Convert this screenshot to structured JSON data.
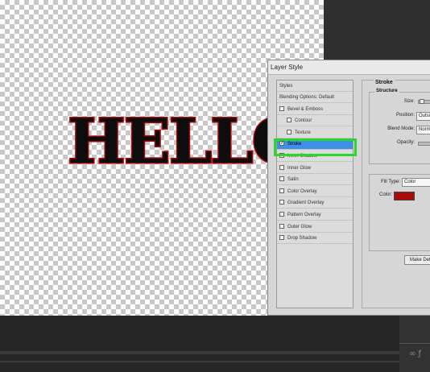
{
  "canvas": {
    "text": "HELLO",
    "text_color": "#0d0d0d",
    "stroke_color": "#b01010"
  },
  "dialog": {
    "title": "Layer Style",
    "styles_header": "Styles",
    "items": [
      {
        "label": "Blending Options: Default",
        "checkbox": false
      },
      {
        "label": "Bevel & Emboss",
        "checkbox": true,
        "checked": false
      },
      {
        "label": "Contour",
        "checkbox": true,
        "checked": false,
        "indent": true
      },
      {
        "label": "Texture",
        "checkbox": true,
        "checked": false,
        "indent": true
      },
      {
        "label": "Stroke",
        "checkbox": true,
        "checked": true,
        "selected": true
      },
      {
        "label": "Inner Shadow",
        "checkbox": true,
        "checked": false
      },
      {
        "label": "Inner Glow",
        "checkbox": true,
        "checked": false
      },
      {
        "label": "Satin",
        "checkbox": true,
        "checked": false
      },
      {
        "label": "Color Overlay",
        "checkbox": true,
        "checked": false
      },
      {
        "label": "Gradient Overlay",
        "checkbox": true,
        "checked": false
      },
      {
        "label": "Pattern Overlay",
        "checkbox": true,
        "checked": false
      },
      {
        "label": "Outer Glow",
        "checkbox": true,
        "checked": false
      },
      {
        "label": "Drop Shadow",
        "checkbox": true,
        "checked": false
      }
    ],
    "stroke": {
      "group_title": "Stroke",
      "structure_title": "Structure",
      "size_label": "Size:",
      "position_label": "Position:",
      "position_value": "Outside",
      "blend_label": "Blend Mode:",
      "blend_value": "Normal",
      "opacity_label": "Opacity:",
      "fill_type_label": "Fill Type:",
      "fill_type_value": "Color",
      "color_label": "Color:",
      "color_value": "#a80c0c",
      "make_default_label": "Make Def"
    }
  },
  "highlight_color": "#2ad62a",
  "selection_color": "#3d8fe8"
}
